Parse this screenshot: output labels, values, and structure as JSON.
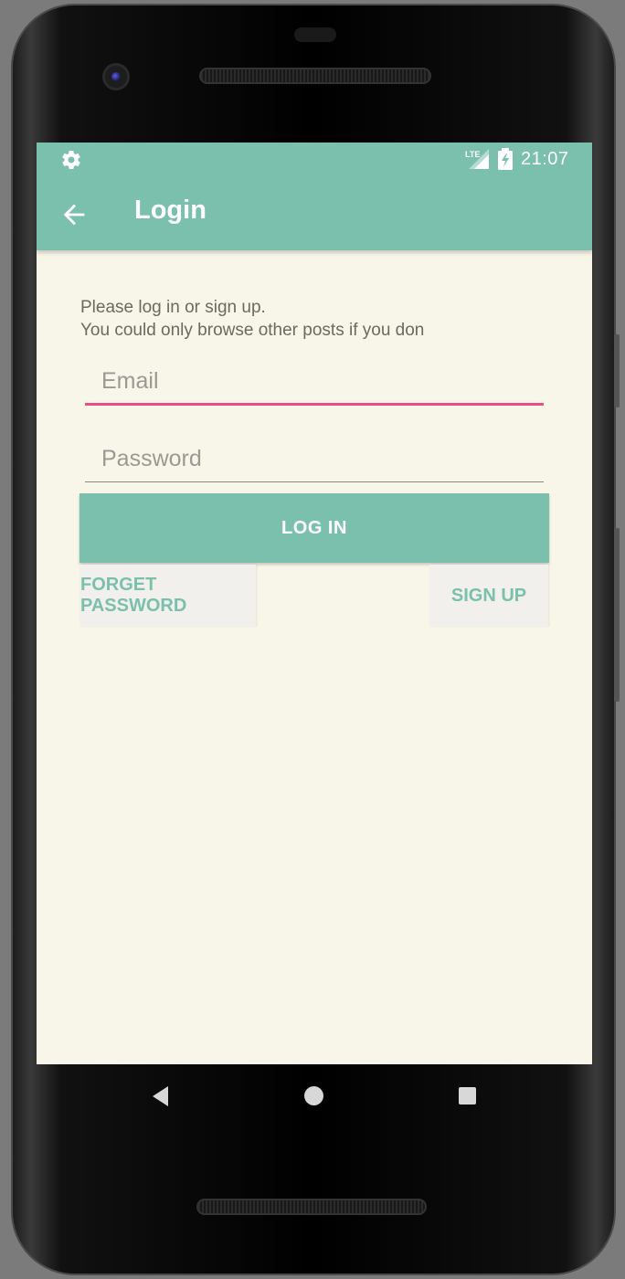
{
  "status_bar": {
    "time": "21:07",
    "network": "LTE",
    "icons": [
      "gear-icon",
      "lte-signal-icon",
      "battery-charging-icon"
    ]
  },
  "app_bar": {
    "title": "Login",
    "back_icon": "arrow-back-icon"
  },
  "login_form": {
    "intro_line1": "Please log in or sign up.",
    "intro_line2": "You could only browse other posts if you don",
    "email_placeholder": "Email",
    "email_value": "",
    "password_placeholder": "Password",
    "password_value": "",
    "login_label": "LOG IN",
    "forget_password_label": "FORGET PASSWORD",
    "sign_up_label": "SIGN UP"
  },
  "nav_bar": {
    "icons": [
      "nav-back-icon",
      "nav-home-icon",
      "nav-recents-icon"
    ]
  },
  "colors": {
    "primary": "#7bbfad",
    "accent": "#e84f86",
    "background": "#f8f6e8",
    "button_text": "#ffffff",
    "link_text": "#7bbfad"
  }
}
